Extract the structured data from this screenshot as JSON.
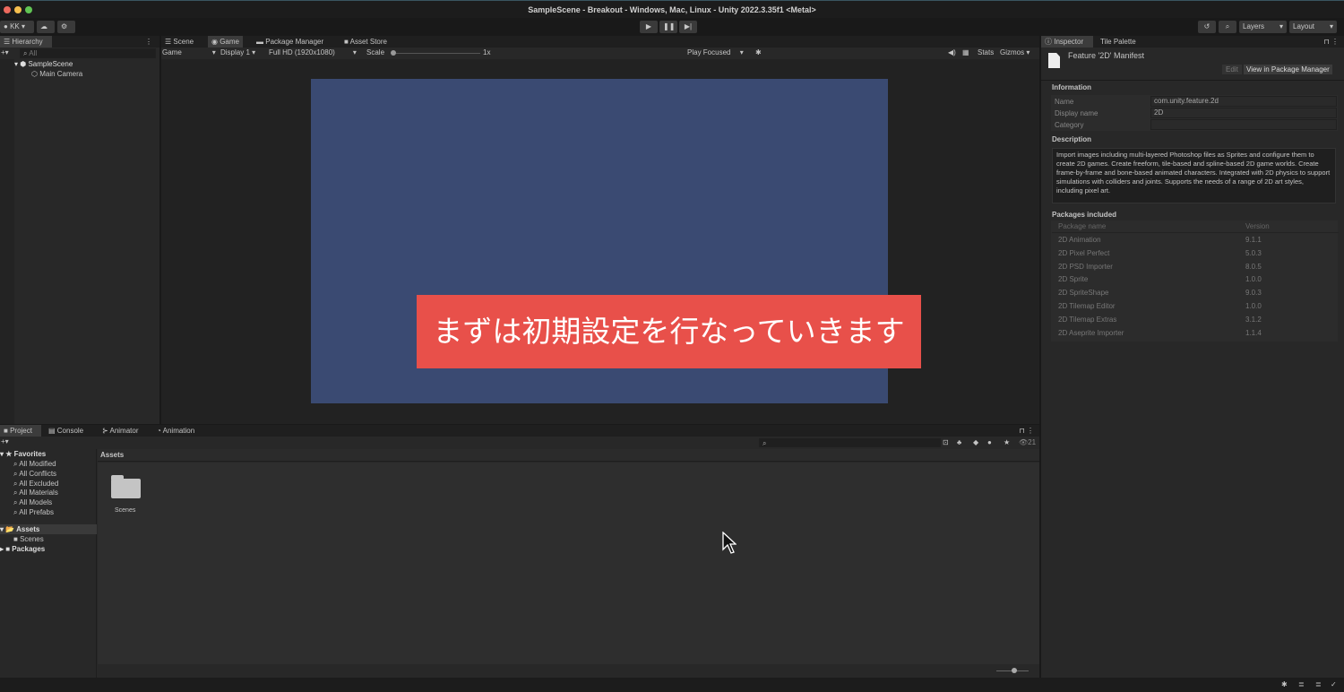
{
  "window": {
    "title": "SampleScene - Breakout - Windows, Mac, Linux - Unity 2022.3.35f1 <Metal>"
  },
  "toolbar": {
    "account": "KK",
    "layers": "Layers",
    "layout": "Layout"
  },
  "hierarchy": {
    "tab": "Hierarchy",
    "search_placeholder": "All",
    "scene": "SampleScene",
    "items": [
      "Main Camera"
    ]
  },
  "center_tabs": [
    "Scene",
    "Game",
    "Package Manager",
    "Asset Store"
  ],
  "game_toolbar": {
    "mode": "Game",
    "display": "Display 1",
    "resolution": "Full HD (1920x1080)",
    "scale_label": "Scale",
    "scale_value": "1x",
    "play_mode": "Play Focused",
    "stats": "Stats",
    "gizmos": "Gizmos"
  },
  "caption": "まずは初期設定を行なっていきます",
  "colors": {
    "game_bg": "#3a4a72",
    "caption_bg": "#e8504a"
  },
  "inspector": {
    "tabs": [
      "Inspector",
      "Tile Palette"
    ],
    "asset_title": "Feature '2D' Manifest",
    "edit": "Edit",
    "view_pm": "View in Package Manager",
    "information": "Information",
    "fields": [
      {
        "label": "Name",
        "value": "com.unity.feature.2d"
      },
      {
        "label": "Display name",
        "value": "2D"
      },
      {
        "label": "Category",
        "value": ""
      }
    ],
    "description_label": "Description",
    "description": "Import images including multi-layered Photoshop files as Sprites and configure them to create 2D games. Create freeform, tile-based and spline-based 2D game worlds. Create frame-by-frame and bone-based animated characters. Integrated with 2D physics to support simulations with colliders and joints. Supports the needs of a range of 2D art styles, including pixel art.",
    "packages_label": "Packages included",
    "pkg_headers": [
      "Package name",
      "Version"
    ],
    "packages": [
      [
        "2D Animation",
        "9.1.1"
      ],
      [
        "2D Pixel Perfect",
        "5.0.3"
      ],
      [
        "2D PSD Importer",
        "8.0.5"
      ],
      [
        "2D Sprite",
        "1.0.0"
      ],
      [
        "2D SpriteShape",
        "9.0.3"
      ],
      [
        "2D Tilemap Editor",
        "1.0.0"
      ],
      [
        "2D Tilemap Extras",
        "3.1.2"
      ],
      [
        "2D Aseprite Importer",
        "1.1.4"
      ]
    ]
  },
  "bottom_tabs": [
    "Project",
    "Console",
    "Animator",
    "Animation"
  ],
  "project": {
    "favorites": "Favorites",
    "fav_items": [
      "All Modified",
      "All Conflicts",
      "All Excluded",
      "All Materials",
      "All Models",
      "All Prefabs"
    ],
    "assets": "Assets",
    "assets_children": [
      "Scenes"
    ],
    "packages": "Packages",
    "breadcrumb": "Assets",
    "grid_items": [
      "Scenes"
    ],
    "hidden_count": "21"
  }
}
